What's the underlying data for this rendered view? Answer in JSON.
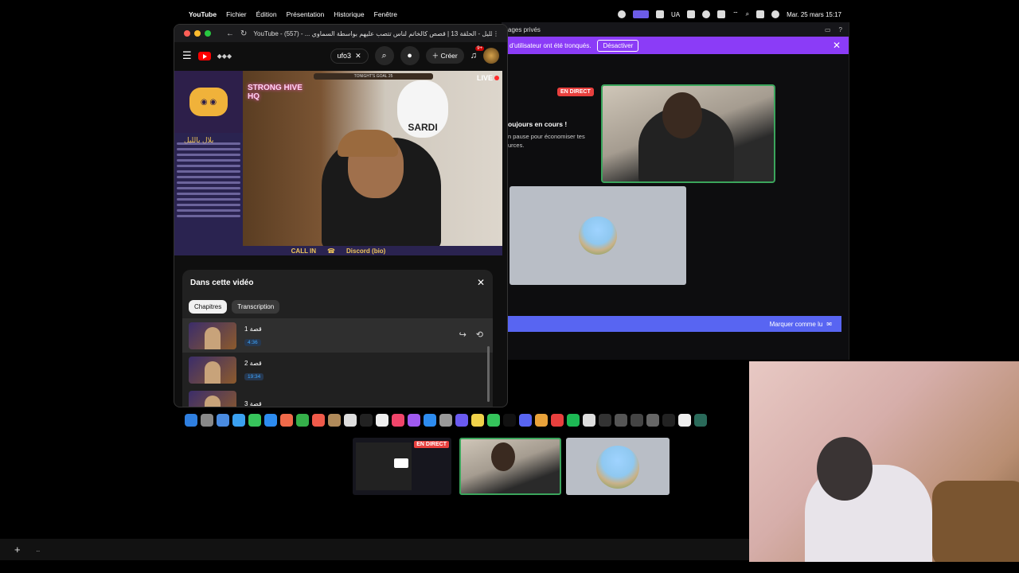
{
  "menubar": {
    "app": "YouTube",
    "items": [
      "Fichier",
      "Édition",
      "Présentation",
      "Historique",
      "Fenêtre"
    ],
    "lang": "UA",
    "datetime": "Mar. 25 mars  15:17"
  },
  "bg_app": {
    "top_text": "ages privés",
    "banner_text": "d'utilisateur ont été tronqués.",
    "banner_button": "Désactiver",
    "live_badge": "EN DIRECT",
    "status_title": "oujours en cours !",
    "status_sub": "n pause pour économiser tes\nurces.",
    "mark_read": "Marquer comme lu"
  },
  "browser": {
    "title": "YouTube - (557) - ... بلال بالليل - الحلقة 13 | قصص كالخاتم لناس تتصب عليهم بواسطة السماوي"
  },
  "youtube": {
    "search_value": "ufo3",
    "create_label": "Créer",
    "notif_count": "9+"
  },
  "video": {
    "live": "LIVE",
    "goal": "TONIGHT'S GOAL",
    "goal_num": "25",
    "neon": "STRONG HIVE HQ",
    "mascot": "SARDI",
    "arabic_title": "بلال بالليل",
    "call_in": "CALL IN",
    "discord": "Discord (bio)"
  },
  "chapters_panel": {
    "title": "Dans cette vidéo",
    "tabs": [
      "Chapitres",
      "Transcription"
    ],
    "items": [
      {
        "label": "قصة 1",
        "time": "4:36"
      },
      {
        "label": "قصة 2",
        "time": "19:34"
      },
      {
        "label": "قصة 3",
        "time": ""
      }
    ]
  },
  "bottom": {
    "live_badge": "EN DIRECT",
    "add": "+",
    "dots": ".."
  }
}
